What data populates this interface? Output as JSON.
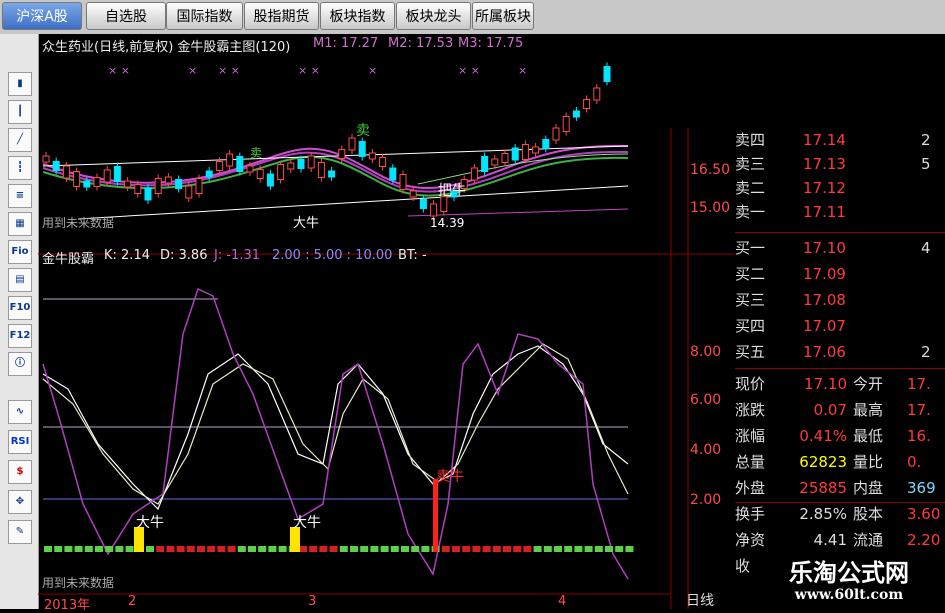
{
  "tabs": [
    {
      "label": "沪深A股",
      "active": true
    },
    {
      "label": "自选股"
    },
    {
      "label": "国际指数"
    },
    {
      "label": "股指期货"
    },
    {
      "label": "板块指数"
    },
    {
      "label": "板块龙头"
    },
    {
      "label": "所属板块"
    }
  ],
  "toolbar": {
    "items": [
      "bar-chart-icon",
      "candle-icon",
      "line-chart-icon",
      "candle-icon",
      "list-icon",
      "grid-icon",
      "Fio",
      "table-icon",
      "F10",
      "F12",
      "info-icon",
      "wave-icon",
      "RSI",
      "dollar-icon",
      "move-icon",
      "pen-icon"
    ]
  },
  "main_chart": {
    "title": "众生药业(日线,前复权) 金牛股霸主图(120)",
    "m1": "M1: 17.27",
    "m2": "M2: 17.53",
    "m3": "M3: 17.75",
    "axis_ticks": [
      "16.50",
      "15.00"
    ],
    "annotations": {
      "sell1": "卖",
      "sell2": "卖",
      "hold": "把牛",
      "bull": "大牛",
      "low": "14.39",
      "footer": "用到未来数据"
    }
  },
  "indicator": {
    "title": "金牛股霸",
    "k": "K: 2.14",
    "d": "D: 3.86",
    "j": "J: -1.31",
    "levels": "2.00 : 5.00 : 10.00",
    "bt": "BT: -",
    "axis_ticks": [
      "8.00",
      "6.00",
      "4.00",
      "2.00"
    ],
    "signals": [
      "大牛",
      "大牛",
      "卖牛"
    ],
    "footer": "用到未来数据",
    "x_labels": [
      "2013年",
      "2",
      "3",
      "4"
    ]
  },
  "quote": {
    "asks": [
      {
        "label": "卖四",
        "price": "17.14",
        "vol": "2"
      },
      {
        "label": "卖三",
        "price": "17.13",
        "vol": "5"
      },
      {
        "label": "卖二",
        "price": "17.12",
        "vol": ""
      },
      {
        "label": "卖一",
        "price": "17.11",
        "vol": ""
      }
    ],
    "bids": [
      {
        "label": "买一",
        "price": "17.10",
        "vol": "4"
      },
      {
        "label": "买二",
        "price": "17.09",
        "vol": ""
      },
      {
        "label": "买三",
        "price": "17.08",
        "vol": ""
      },
      {
        "label": "买四",
        "price": "17.07",
        "vol": ""
      },
      {
        "label": "买五",
        "price": "17.06",
        "vol": "2"
      }
    ],
    "stats": [
      {
        "l1": "现价",
        "v1": "17.10",
        "l2": "今开",
        "v2": "17."
      },
      {
        "l1": "涨跌",
        "v1": "0.07",
        "l2": "最高",
        "v2": "17."
      },
      {
        "l1": "涨幅",
        "v1": "0.41%",
        "l2": "最低",
        "v2": "16."
      },
      {
        "l1": "总量",
        "v1": "62823",
        "l2": "量比",
        "v2": "0."
      },
      {
        "l1": "外盘",
        "v1": "25885",
        "l2": "内盘",
        "v2": "369"
      },
      {
        "l1": "换手",
        "v1": "2.85%",
        "l2": "股本",
        "v2": "3.60"
      },
      {
        "l1": "净资",
        "v1": "4.41",
        "l2": "流通",
        "v2": "2.20"
      },
      {
        "l1": "收",
        "v1": "",
        "l2": "",
        "v2": ""
      }
    ],
    "period": "日线"
  },
  "watermark": {
    "line1": "乐淘公式网",
    "line2": "www.60lt.com"
  },
  "colors": {
    "up": "#ff3b3b",
    "down": "#00e5ff",
    "bg": "#000000"
  }
}
